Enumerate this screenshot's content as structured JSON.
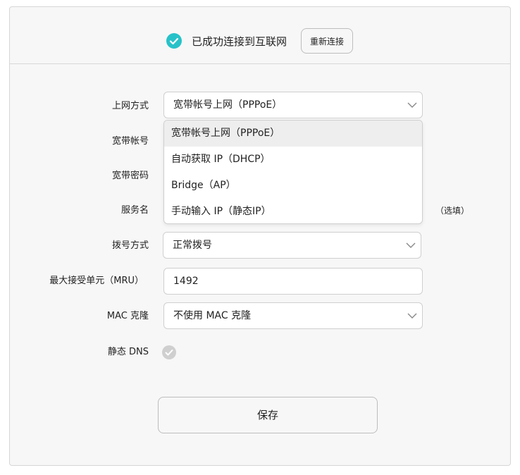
{
  "status": {
    "connected_text": "已成功连接到互联网",
    "reconnect_label": "重新连接"
  },
  "form": {
    "connection_type": {
      "label": "上网方式",
      "value": "宽带帐号上网（PPPoE）"
    },
    "account": {
      "label": "宽带帐号"
    },
    "password": {
      "label": "宽带密码"
    },
    "service_name": {
      "label": "服务名",
      "hint": "（选填）"
    },
    "dial_mode": {
      "label": "拨号方式",
      "value": "正常拨号"
    },
    "mru": {
      "label": "最大接受单元（MRU）",
      "value": "1492"
    },
    "mac_clone": {
      "label": "MAC 克隆",
      "value": "不使用 MAC 克隆"
    },
    "static_dns": {
      "label": "静态 DNS",
      "enabled": false
    }
  },
  "dropdown": {
    "options": [
      {
        "label": "宽带帐号上网（PPPoE）",
        "selected": true
      },
      {
        "label": "自动获取 IP（DHCP）",
        "selected": false
      },
      {
        "label": "Bridge（AP）",
        "selected": false
      },
      {
        "label": "手动输入 IP（静态IP）",
        "selected": false
      }
    ]
  },
  "actions": {
    "save_label": "保存"
  },
  "colors": {
    "accent": "#27c2c9",
    "disabled": "#cfcfcf"
  },
  "icons": {
    "status": "check-circle-icon",
    "select": "chevron-down-icon",
    "toggle": "check-toggle-icon"
  }
}
